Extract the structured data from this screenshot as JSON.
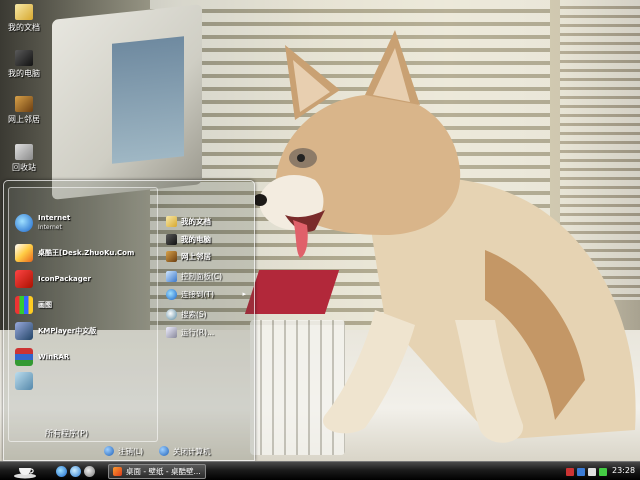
{
  "desktop_icons": [
    {
      "label": "我的文档",
      "icon": "my-documents-icon"
    },
    {
      "label": "我的电脑",
      "icon": "my-computer-icon"
    },
    {
      "label": "网上邻居",
      "icon": "network-places-icon"
    },
    {
      "label": "回收站",
      "icon": "recycle-bin-icon"
    }
  ],
  "start_menu": {
    "pinned": [
      {
        "title": "Internet",
        "subtitle": "Internet",
        "icon": "internet-explorer-icon"
      },
      {
        "title": "桌酷王[Desk.ZhuoKu.Com",
        "icon": "zhuoku-icon"
      },
      {
        "title": "IconPackager",
        "icon": "iconpackager-icon"
      },
      {
        "title": "画图",
        "icon": "paint-icon"
      },
      {
        "title": "KMPlayer中文版",
        "icon": "kmplayer-icon"
      },
      {
        "title": "WinRAR",
        "icon": "winrar-icon"
      }
    ],
    "all_programs": "所有程序(P)",
    "places": [
      {
        "label": "我的文档",
        "icon": "my-documents-icon",
        "bold": true
      },
      {
        "label": "我的电脑",
        "icon": "my-computer-icon",
        "bold": true
      },
      {
        "label": "网上邻居",
        "icon": "network-places-icon",
        "bold": true
      },
      {
        "label": "控制面板(C)",
        "icon": "control-panel-icon",
        "bold": false
      },
      {
        "label": "连接到(T)",
        "icon": "connect-to-icon",
        "bold": false,
        "submenu": true
      },
      {
        "label": "搜索(S)",
        "icon": "search-icon",
        "bold": false
      },
      {
        "label": "运行(R)...",
        "icon": "run-icon",
        "bold": false
      }
    ],
    "footer": {
      "logoff": "注销(L)",
      "shutdown": "关闭计算机"
    }
  },
  "taskbar": {
    "task_label": "桌面 - 壁纸 - 桌酷壁...",
    "clock": "23:28"
  },
  "colors": {
    "taskbar": "#000000",
    "mousepad": "#b2283a",
    "accent_blue": "#1c5fb8"
  }
}
